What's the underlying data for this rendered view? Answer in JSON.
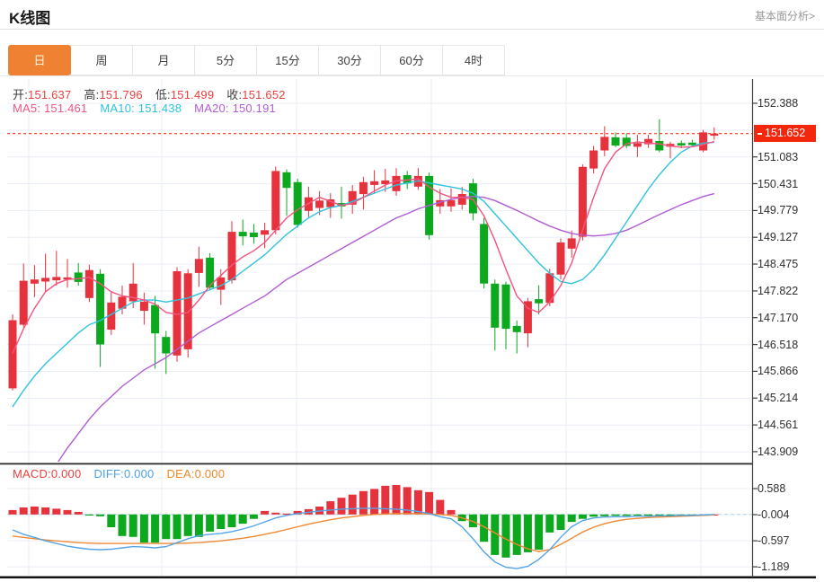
{
  "header": {
    "title": "K线图",
    "link_label": "基本面分析>"
  },
  "tabs": {
    "items": [
      "日",
      "周",
      "月",
      "5分",
      "15分",
      "30分",
      "60分",
      "4时"
    ],
    "active_index": 0,
    "active_label": "日"
  },
  "legends": {
    "ohlc": [
      {
        "label": "开:",
        "value": "151.637",
        "label_color": "#3c3c3c",
        "color": "#e8403f"
      },
      {
        "label": "高:",
        "value": "151.796",
        "label_color": "#3c3c3c",
        "color": "#e8403f"
      },
      {
        "label": "低:",
        "value": "151.499",
        "label_color": "#3c3c3c",
        "color": "#e8403f"
      },
      {
        "label": "收:",
        "value": "151.652",
        "label_color": "#3c3c3c",
        "color": "#e8403f"
      }
    ],
    "ma": [
      {
        "label": "MA5: ",
        "value": "151.461",
        "color": "#f4547f"
      },
      {
        "label": "MA10: ",
        "value": "151.438",
        "color": "#2ec3df"
      },
      {
        "label": "MA20: ",
        "value": "150.191",
        "color": "#b15dd4"
      }
    ],
    "macd": [
      {
        "label": "MACD:",
        "value": "0.000",
        "color": "#e8413e"
      },
      {
        "label": "DIFF:",
        "value": "0.000",
        "color": "#4aa1e8"
      },
      {
        "label": "DEA:",
        "value": "0.000",
        "color": "#f0882b"
      }
    ]
  },
  "price_axis": {
    "ticks": [
      152.388,
      151.083,
      150.431,
      149.779,
      149.127,
      148.475,
      147.822,
      147.17,
      146.518,
      145.866,
      145.214,
      144.561,
      143.909
    ],
    "current_price_label": "151.652"
  },
  "macd_axis": {
    "ticks": [
      0.588,
      -0.004,
      -0.597,
      -1.189
    ]
  },
  "chart_data": {
    "type": "candlestick",
    "title": "K线图",
    "legend_position": "top-left-overlay",
    "grid": true,
    "price_axis_range": [
      143.909,
      152.388
    ],
    "price_tick_step": 0.6525,
    "macd_axis_range": [
      -1.189,
      0.588
    ],
    "current_price": 151.652,
    "up_color": "#e5323c",
    "down_color": "#0ca81e",
    "candles_ohlc": [
      [
        145.45,
        147.25,
        145.4,
        147.11
      ],
      [
        147.0,
        148.49,
        146.93,
        148.07
      ],
      [
        148.0,
        148.45,
        147.67,
        148.1
      ],
      [
        148.05,
        148.73,
        147.8,
        148.14
      ],
      [
        148.08,
        148.8,
        147.95,
        148.16
      ],
      [
        148.1,
        148.6,
        147.9,
        148.15
      ],
      [
        148.27,
        148.5,
        147.95,
        148.04
      ],
      [
        147.65,
        148.46,
        147.55,
        148.33
      ],
      [
        148.24,
        148.35,
        145.97,
        146.52
      ],
      [
        146.88,
        147.8,
        146.75,
        147.54
      ],
      [
        147.39,
        147.95,
        147.25,
        147.68
      ],
      [
        147.57,
        148.5,
        147.4,
        148.0
      ],
      [
        147.34,
        147.78,
        147.0,
        147.56
      ],
      [
        147.48,
        147.7,
        145.93,
        146.79
      ],
      [
        146.7,
        146.85,
        145.8,
        146.3
      ],
      [
        146.25,
        148.4,
        146.1,
        148.3
      ],
      [
        146.4,
        148.35,
        146.2,
        148.25
      ],
      [
        148.26,
        148.9,
        147.92,
        148.6
      ],
      [
        148.63,
        148.74,
        147.85,
        147.9
      ],
      [
        147.85,
        148.35,
        147.48,
        148.15
      ],
      [
        148.08,
        149.52,
        148.0,
        149.26
      ],
      [
        149.26,
        149.56,
        148.93,
        149.15
      ],
      [
        149.24,
        149.45,
        148.97,
        149.13
      ],
      [
        149.19,
        149.48,
        148.86,
        149.3
      ],
      [
        149.3,
        150.85,
        149.2,
        150.74
      ],
      [
        150.71,
        150.78,
        149.65,
        150.33
      ],
      [
        150.47,
        150.55,
        149.36,
        149.43
      ],
      [
        149.77,
        150.36,
        149.62,
        150.1
      ],
      [
        149.84,
        150.25,
        149.67,
        150.02
      ],
      [
        149.86,
        150.2,
        149.6,
        150.05
      ],
      [
        149.96,
        150.36,
        149.58,
        149.88
      ],
      [
        149.92,
        150.4,
        149.7,
        150.25
      ],
      [
        150.18,
        150.6,
        149.8,
        150.47
      ],
      [
        150.4,
        150.76,
        150.2,
        150.49
      ],
      [
        150.42,
        150.79,
        150.23,
        150.51
      ],
      [
        150.25,
        150.81,
        150.14,
        150.62
      ],
      [
        150.64,
        150.74,
        150.3,
        150.44
      ],
      [
        150.36,
        150.81,
        150.28,
        150.62
      ],
      [
        150.62,
        150.7,
        149.07,
        149.18
      ],
      [
        149.88,
        150.3,
        149.7,
        150.03
      ],
      [
        149.88,
        150.32,
        149.75,
        150.03
      ],
      [
        149.92,
        150.35,
        149.8,
        150.18
      ],
      [
        150.44,
        150.55,
        149.54,
        149.71
      ],
      [
        149.45,
        149.6,
        147.88,
        148.0
      ],
      [
        148.0,
        148.1,
        146.37,
        146.93
      ],
      [
        147.98,
        148.05,
        146.4,
        146.9
      ],
      [
        146.97,
        147.1,
        146.3,
        146.82
      ],
      [
        146.79,
        147.65,
        146.45,
        147.57
      ],
      [
        147.62,
        147.96,
        147.25,
        147.52
      ],
      [
        147.53,
        148.36,
        147.45,
        148.25
      ],
      [
        148.22,
        149.1,
        148.1,
        149.0
      ],
      [
        148.85,
        149.29,
        148.63,
        149.1
      ],
      [
        149.14,
        150.9,
        149.05,
        150.84
      ],
      [
        150.8,
        151.35,
        150.68,
        151.24
      ],
      [
        151.24,
        151.83,
        151.1,
        151.57
      ],
      [
        151.56,
        151.68,
        151.32,
        151.36
      ],
      [
        151.55,
        151.66,
        151.3,
        151.35
      ],
      [
        151.33,
        151.62,
        151.08,
        151.42
      ],
      [
        151.39,
        151.62,
        151.3,
        151.52
      ],
      [
        151.47,
        152.0,
        151.2,
        151.24
      ],
      [
        151.33,
        151.45,
        151.05,
        151.4
      ],
      [
        151.42,
        151.48,
        151.3,
        151.36
      ],
      [
        151.43,
        151.5,
        151.32,
        151.37
      ],
      [
        151.24,
        151.74,
        151.2,
        151.68
      ],
      [
        151.6,
        151.8,
        151.5,
        151.652
      ]
    ],
    "ma5": [
      146.3,
      146.9,
      147.4,
      147.8,
      148.0,
      148.1,
      148.12,
      148.15,
      148.0,
      147.8,
      147.7,
      147.66,
      147.6,
      147.5,
      147.3,
      147.25,
      147.3,
      147.6,
      147.95,
      148.2,
      148.45,
      148.65,
      148.8,
      149.0,
      149.3,
      149.6,
      149.8,
      149.95,
      150.1,
      150.0,
      149.9,
      149.95,
      150.1,
      150.25,
      150.4,
      150.5,
      150.52,
      150.55,
      150.35,
      150.2,
      150.1,
      150.1,
      150.05,
      149.65,
      149.05,
      148.35,
      147.7,
      147.4,
      147.3,
      147.55,
      147.95,
      148.5,
      149.3,
      150.1,
      150.8,
      151.2,
      151.4,
      151.45,
      151.42,
      151.4,
      151.35,
      151.32,
      151.33,
      151.38,
      151.46
    ],
    "ma10": [
      145.0,
      145.4,
      145.75,
      146.05,
      146.3,
      146.55,
      146.8,
      147.0,
      147.1,
      147.25,
      147.4,
      147.55,
      147.6,
      147.6,
      147.55,
      147.6,
      147.65,
      147.75,
      147.85,
      147.95,
      148.1,
      148.3,
      148.5,
      148.7,
      148.95,
      149.2,
      149.4,
      149.6,
      149.75,
      149.85,
      149.9,
      150.0,
      150.1,
      150.2,
      150.3,
      150.4,
      150.45,
      150.5,
      150.45,
      150.4,
      150.35,
      150.3,
      150.2,
      150.0,
      149.7,
      149.4,
      149.1,
      148.8,
      148.5,
      148.25,
      148.05,
      148.0,
      148.1,
      148.35,
      148.7,
      149.1,
      149.5,
      149.9,
      150.3,
      150.65,
      150.95,
      151.2,
      151.35,
      151.42,
      151.44
    ],
    "ma20": [
      141.7,
      142.2,
      142.7,
      143.15,
      143.6,
      144.0,
      144.35,
      144.7,
      145.0,
      145.25,
      145.5,
      145.7,
      145.9,
      146.05,
      146.2,
      146.4,
      146.6,
      146.8,
      146.95,
      147.1,
      147.25,
      147.4,
      147.55,
      147.7,
      147.9,
      148.1,
      148.25,
      148.4,
      148.55,
      148.7,
      148.85,
      149.0,
      149.15,
      149.3,
      149.45,
      149.6,
      149.7,
      149.82,
      149.9,
      149.98,
      150.05,
      150.1,
      150.12,
      150.1,
      150.02,
      149.9,
      149.78,
      149.65,
      149.52,
      149.4,
      149.3,
      149.22,
      149.18,
      149.16,
      149.18,
      149.22,
      149.3,
      149.42,
      149.55,
      149.68,
      149.8,
      149.92,
      150.02,
      150.12,
      150.19
    ],
    "macd_hist": [
      0.1,
      0.16,
      0.18,
      0.16,
      0.13,
      0.1,
      0.06,
      -0.02,
      -0.04,
      -0.29,
      -0.49,
      -0.51,
      -0.64,
      -0.64,
      -0.56,
      -0.56,
      -0.49,
      -0.51,
      -0.39,
      -0.33,
      -0.29,
      -0.21,
      -0.1,
      0.08,
      0.04,
      0.02,
      0.08,
      0.12,
      0.18,
      0.3,
      0.38,
      0.45,
      0.53,
      0.58,
      0.65,
      0.67,
      0.62,
      0.55,
      0.51,
      0.33,
      0.1,
      -0.15,
      -0.29,
      -0.62,
      -0.92,
      -0.98,
      -0.92,
      -0.86,
      -0.8,
      -0.41,
      -0.35,
      -0.17,
      -0.1,
      -0.05,
      -0.04,
      -0.03,
      -0.03,
      -0.02,
      -0.02,
      -0.02,
      -0.01,
      -0.01,
      -0.01,
      0.0,
      0.0
    ],
    "diff": [
      -0.35,
      -0.45,
      -0.52,
      -0.6,
      -0.66,
      -0.72,
      -0.76,
      -0.79,
      -0.8,
      -0.79,
      -0.76,
      -0.73,
      -0.74,
      -0.76,
      -0.73,
      -0.64,
      -0.55,
      -0.48,
      -0.45,
      -0.43,
      -0.39,
      -0.33,
      -0.26,
      -0.17,
      -0.08,
      -0.02,
      0.02,
      0.05,
      0.08,
      0.1,
      0.12,
      0.13,
      0.14,
      0.14,
      0.13,
      0.12,
      0.1,
      0.07,
      0.02,
      -0.05,
      -0.1,
      -0.28,
      -0.55,
      -0.85,
      -1.08,
      -1.2,
      -1.23,
      -1.18,
      -1.02,
      -0.8,
      -0.52,
      -0.28,
      -0.14,
      -0.08,
      -0.06,
      -0.05,
      -0.05,
      -0.04,
      -0.04,
      -0.03,
      -0.03,
      -0.02,
      -0.02,
      -0.01,
      0.0
    ],
    "dea": [
      -0.49,
      -0.52,
      -0.55,
      -0.58,
      -0.6,
      -0.62,
      -0.64,
      -0.65,
      -0.66,
      -0.66,
      -0.66,
      -0.66,
      -0.66,
      -0.66,
      -0.66,
      -0.66,
      -0.65,
      -0.64,
      -0.62,
      -0.6,
      -0.57,
      -0.54,
      -0.5,
      -0.45,
      -0.4,
      -0.34,
      -0.28,
      -0.22,
      -0.17,
      -0.12,
      -0.08,
      -0.05,
      -0.02,
      0.0,
      0.01,
      0.02,
      0.02,
      0.02,
      0.01,
      0.0,
      -0.02,
      -0.08,
      -0.16,
      -0.28,
      -0.42,
      -0.56,
      -0.68,
      -0.78,
      -0.84,
      -0.8,
      -0.68,
      -0.54,
      -0.4,
      -0.29,
      -0.21,
      -0.15,
      -0.11,
      -0.09,
      -0.07,
      -0.06,
      -0.05,
      -0.04,
      -0.03,
      -0.02,
      -0.01
    ]
  },
  "colors": {
    "tab_active_bg": "#ee8132",
    "up": "#e5323c",
    "down": "#0ca81e",
    "ma5": "#f4547f",
    "ma10": "#2ec3df",
    "ma20": "#b15dd4",
    "diff_line": "#55a4e6",
    "dea_line": "#ef8832",
    "current_price_line": "#fb2f1d",
    "current_price_bg": "#f2270c",
    "grid": "#e9eef5"
  }
}
